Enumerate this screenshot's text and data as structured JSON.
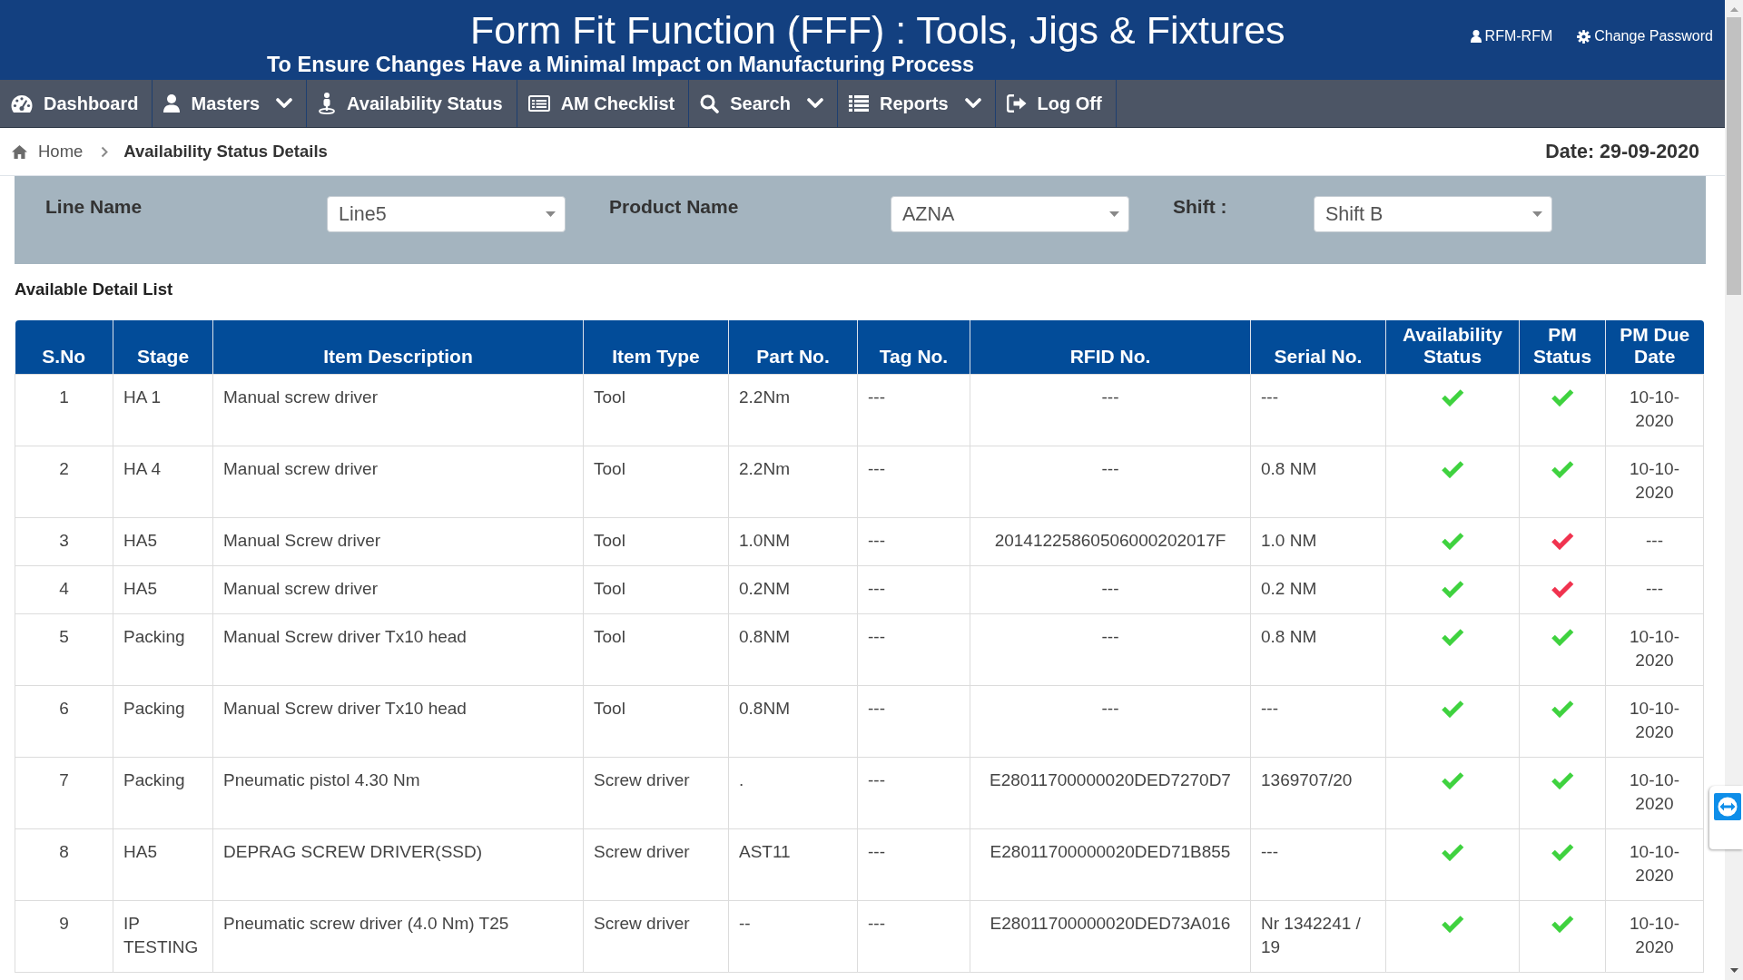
{
  "header": {
    "title": "Form Fit Function (FFF) : Tools, Jigs & Fixtures",
    "subtitle": "To Ensure Changes Have a Minimal Impact on Manufacturing Process",
    "user": "RFM-RFM",
    "change_password": "Change Password"
  },
  "nav": [
    {
      "label": "Dashboard",
      "dropdown": false
    },
    {
      "label": "Masters",
      "dropdown": true
    },
    {
      "label": "Availability Status",
      "dropdown": false
    },
    {
      "label": "AM Checklist",
      "dropdown": false
    },
    {
      "label": "Search",
      "dropdown": true
    },
    {
      "label": "Reports",
      "dropdown": true
    },
    {
      "label": "Log Off",
      "dropdown": false
    }
  ],
  "breadcrumb": [
    "Home",
    "Availability Status Details"
  ],
  "date": "Date: 29-09-2020",
  "filters": [
    {
      "label": "Line Name",
      "value": "Line5"
    },
    {
      "label": "Product Name",
      "value": "AZNA"
    },
    {
      "label": "Shift :",
      "value": "Shift B"
    }
  ],
  "list_title": "Available Detail List",
  "table": {
    "columns": [
      "S.No",
      "Stage",
      "Item Description",
      "Item Type",
      "Part No.",
      "Tag No.",
      "RFID No.",
      "Serial No.",
      "Availability Status",
      "PM Status",
      "PM Due Date"
    ],
    "rows": [
      {
        "s_no": "1",
        "stage": "HA 1",
        "item_description": "Manual screw driver",
        "item_type": "Tool",
        "part_no": "2.2Nm",
        "tag_no": "---",
        "rfid_no": "---",
        "serial_no": "---",
        "availability_ok": true,
        "pm_ok": true,
        "pm_due_date": "10-10-2020"
      },
      {
        "s_no": "2",
        "stage": "HA 4",
        "item_description": "Manual screw driver",
        "item_type": "Tool",
        "part_no": "2.2Nm",
        "tag_no": "---",
        "rfid_no": "---",
        "serial_no": "0.8 NM",
        "availability_ok": true,
        "pm_ok": true,
        "pm_due_date": "10-10-2020"
      },
      {
        "s_no": "3",
        "stage": "HA5",
        "item_description": "Manual Screw driver",
        "item_type": "Tool",
        "part_no": "1.0NM",
        "tag_no": "---",
        "rfid_no": "20141225860506000202017F",
        "serial_no": "1.0 NM",
        "availability_ok": true,
        "pm_ok": false,
        "pm_due_date": "---"
      },
      {
        "s_no": "4",
        "stage": "HA5",
        "item_description": "Manual screw driver",
        "item_type": "Tool",
        "part_no": "0.2NM",
        "tag_no": "---",
        "rfid_no": "---",
        "serial_no": "0.2 NM",
        "availability_ok": true,
        "pm_ok": false,
        "pm_due_date": "---"
      },
      {
        "s_no": "5",
        "stage": "Packing",
        "item_description": "Manual Screw driver Tx10 head",
        "item_type": "Tool",
        "part_no": "0.8NM",
        "tag_no": "---",
        "rfid_no": "---",
        "serial_no": "0.8 NM",
        "availability_ok": true,
        "pm_ok": true,
        "pm_due_date": "10-10-2020"
      },
      {
        "s_no": "6",
        "stage": "Packing",
        "item_description": "Manual Screw driver Tx10 head",
        "item_type": "Tool",
        "part_no": "0.8NM",
        "tag_no": "---",
        "rfid_no": "---",
        "serial_no": "---",
        "availability_ok": true,
        "pm_ok": true,
        "pm_due_date": "10-10-2020"
      },
      {
        "s_no": "7",
        "stage": "Packing",
        "item_description": "Pneumatic pistol 4.30 Nm",
        "item_type": "Screw driver",
        "part_no": ".",
        "tag_no": "---",
        "rfid_no": "E28011700000020DED7270D7",
        "serial_no": "1369707/20",
        "availability_ok": true,
        "pm_ok": true,
        "pm_due_date": "10-10-2020"
      },
      {
        "s_no": "8",
        "stage": "HA5",
        "item_description": "DEPRAG SCREW DRIVER(SSD)",
        "item_type": "Screw driver",
        "part_no": "AST11",
        "tag_no": "---",
        "rfid_no": "E28011700000020DED71B855",
        "serial_no": "---",
        "availability_ok": true,
        "pm_ok": true,
        "pm_due_date": "10-10-2020"
      },
      {
        "s_no": "9",
        "stage": "IP TESTING",
        "item_description": "Pneumatic screw driver (4.0 Nm) T25",
        "item_type": "Screw driver",
        "part_no": "--",
        "tag_no": "---",
        "rfid_no": "E28011700000020DED73A016",
        "serial_no": "Nr 1342241 / 19",
        "availability_ok": true,
        "pm_ok": true,
        "pm_due_date": "10-10-2020"
      }
    ]
  }
}
